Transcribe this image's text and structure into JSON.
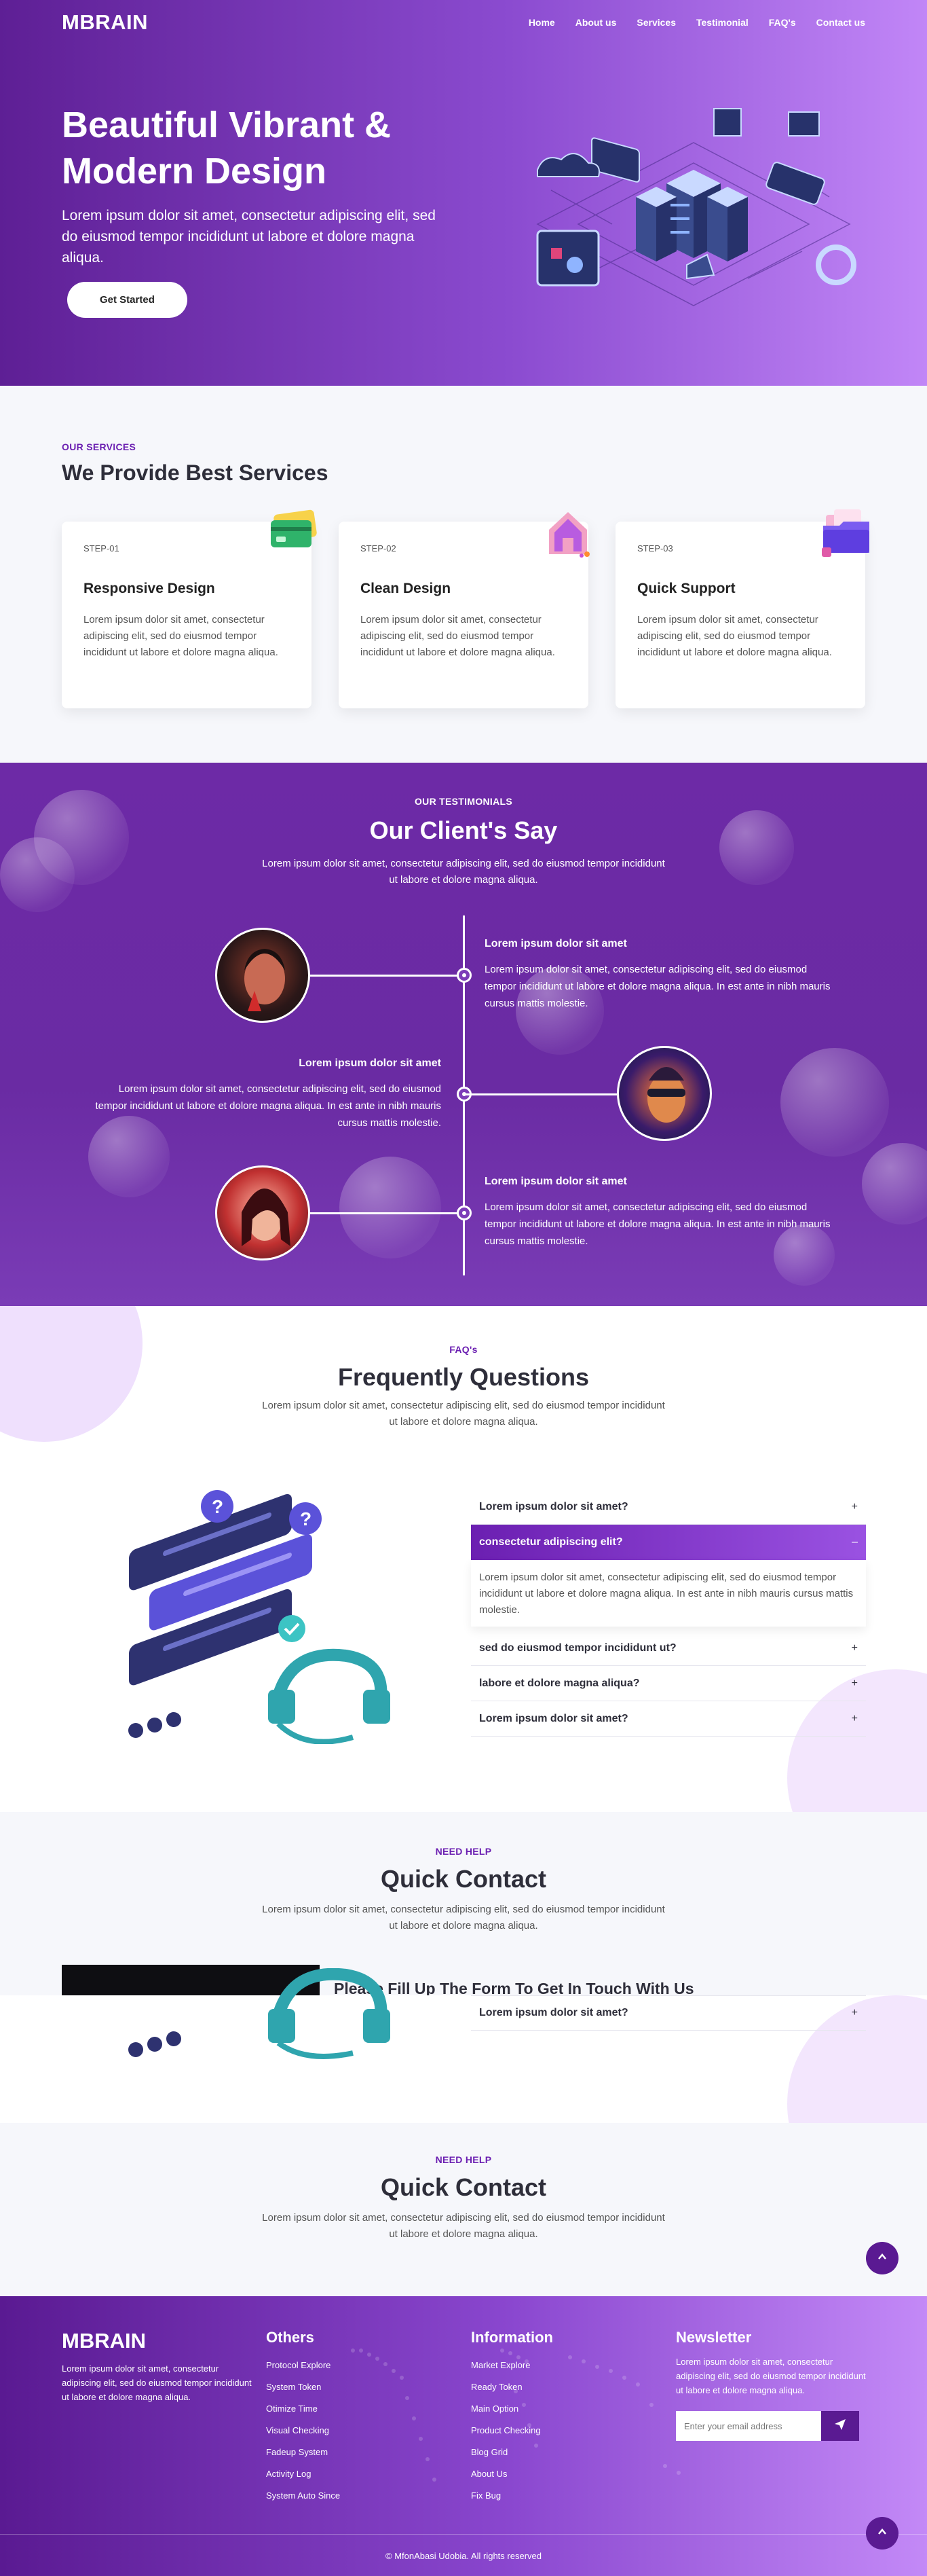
{
  "brand": "MBRAIN",
  "nav": [
    "Home",
    "About us",
    "Services",
    "Testimonial",
    "FAQ's",
    "Contact us"
  ],
  "hero": {
    "title_line1": "Beautiful Vibrant &",
    "title_line2": "Modern Design",
    "subtitle": "Lorem ipsum dolor sit amet, consectetur adipiscing elit, sed do eiusmod tempor incididunt ut labore et dolore magna aliqua.",
    "cta": "Get Started"
  },
  "services": {
    "eyebrow": "OUR SERVICES",
    "title": "We Provide Best Services",
    "cards": [
      {
        "step": "STEP-01",
        "title": "Responsive Design",
        "text": "Lorem ipsum dolor sit amet, consectetur adipiscing elit, sed do eiusmod tempor incididunt ut labore et dolore magna aliqua.",
        "icon": "credit-card-icon"
      },
      {
        "step": "STEP-02",
        "title": "Clean Design",
        "text": "Lorem ipsum dolor sit amet, consectetur adipiscing elit, sed do eiusmod tempor incididunt ut labore et dolore magna aliqua.",
        "icon": "home-icon"
      },
      {
        "step": "STEP-03",
        "title": "Quick Support",
        "text": "Lorem ipsum dolor sit amet, consectetur adipiscing elit, sed do eiusmod tempor incididunt ut labore et dolore magna aliqua.",
        "icon": "folder-icon"
      }
    ]
  },
  "testimonials": {
    "eyebrow": "OUR TESTIMONIALS",
    "title": "Our Client's Say",
    "subtitle": "Lorem ipsum dolor sit amet, consectetur adipiscing elit, sed do eiusmod tempor incididunt ut labore et dolore magna aliqua.",
    "items": [
      {
        "heading": "Lorem ipsum dolor sit amet",
        "text": "Lorem ipsum dolor sit amet, consectetur adipiscing elit, sed do eiusmod tempor incididunt ut labore et dolore magna aliqua. In est ante in nibh mauris cursus mattis molestie."
      },
      {
        "heading": "Lorem ipsum dolor sit amet",
        "text": "Lorem ipsum dolor sit amet, consectetur adipiscing elit, sed do eiusmod tempor incididunt ut labore et dolore magna aliqua. In est ante in nibh mauris cursus mattis molestie."
      },
      {
        "heading": "Lorem ipsum dolor sit amet",
        "text": "Lorem ipsum dolor sit amet, consectetur adipiscing elit, sed do eiusmod tempor incididunt ut labore et dolore magna aliqua. In est ante in nibh mauris cursus mattis molestie."
      }
    ]
  },
  "faq": {
    "eyebrow": "FAQ's",
    "title": "Frequently Questions",
    "subtitle": "Lorem ipsum dolor sit amet, consectetur adipiscing elit, sed do eiusmod tempor incididunt ut labore et dolore magna aliqua.",
    "items": [
      {
        "q": "Lorem ipsum dolor sit amet?",
        "toggle": "+"
      },
      {
        "q": "consectetur adipiscing elit?",
        "toggle": "–",
        "answer": "Lorem ipsum dolor sit amet, consectetur adipiscing elit, sed do eiusmod tempor incididunt ut labore et dolore magna aliqua. In est ante in nibh mauris cursus mattis molestie."
      },
      {
        "q": "sed do eiusmod tempor incididunt ut?",
        "toggle": "+"
      },
      {
        "q": "labore et dolore magna aliqua?",
        "toggle": "+"
      },
      {
        "q": "Lorem ipsum dolor sit amet?",
        "toggle": "+"
      }
    ]
  },
  "contact": {
    "eyebrow": "NEED HELP",
    "title": "Quick Contact",
    "subtitle": "Lorem ipsum dolor sit amet, consectetur adipiscing elit, sed do eiusmod tempor incididunt ut labore et dolore magna aliqua.",
    "form_heading": "Please Fill Up The Form To Get In Touch With Us",
    "repeat_faq": {
      "q": "Lorem ipsum dolor sit amet?",
      "toggle": "+"
    }
  },
  "contact2": {
    "eyebrow": "NEED HELP",
    "title": "Quick Contact",
    "subtitle": "Lorem ipsum dolor sit amet, consectetur adipiscing elit, sed do eiusmod tempor incididunt ut labore et dolore magna aliqua."
  },
  "footer": {
    "brand": "MBRAIN",
    "about": "Lorem ipsum dolor sit amet, consectetur adipiscing elit, sed do eiusmod tempor incididunt ut labore et dolore magna aliqua.",
    "others_title": "Others",
    "others": [
      "Protocol Explore",
      "System Token",
      "Otimize Time",
      "Visual Checking",
      "Fadeup System",
      "Activity Log",
      "System Auto Since"
    ],
    "info_title": "Information",
    "info": [
      "Market Explore",
      "Ready Token",
      "Main Option",
      "Product Checking",
      "Blog Grid",
      "About Us",
      "Fix Bug"
    ],
    "newsletter_title": "Newsletter",
    "newsletter_text": "Lorem ipsum dolor sit amet, consectetur adipiscing elit, sed do eiusmod tempor incididunt ut labore et dolore magna aliqua.",
    "email_placeholder": "Enter your email address",
    "copyright": "© MfonAbasi Udobia. All rights reserved"
  },
  "colors": {
    "primary": "#6b1fb1",
    "accent": "#c186f7",
    "dark": "#2e2e3a"
  }
}
